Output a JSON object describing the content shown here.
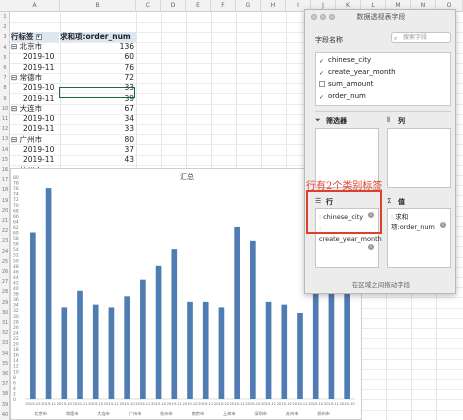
{
  "sheet": {
    "columns": [
      "A",
      "B",
      "C",
      "D",
      "E",
      "F",
      "G",
      "H",
      "I",
      "J",
      "K",
      "L",
      "M",
      "N",
      "O"
    ],
    "rows": [
      "1",
      "2",
      "3",
      "4",
      "5",
      "6",
      "7",
      "8",
      "9",
      "10",
      "11",
      "12",
      "13",
      "14",
      "15",
      "16",
      "17",
      "18",
      "19",
      "20",
      "21",
      "22",
      "23",
      "24",
      "25",
      "26",
      "27",
      "28",
      "29",
      "30",
      "31",
      "32",
      "33",
      "34",
      "35",
      "36",
      "37",
      "38",
      "39",
      "40"
    ]
  },
  "pivot": {
    "header_label": "行标签",
    "header_value": "求和项:order_num",
    "dropdown_glyph": "▾",
    "rows": [
      {
        "label": "⊟ 北京市",
        "value": "136",
        "level": 0
      },
      {
        "label": "2019-10",
        "value": "60",
        "level": 1
      },
      {
        "label": "2019-11",
        "value": "76",
        "level": 1
      },
      {
        "label": "⊟ 常德市",
        "value": "72",
        "level": 0
      },
      {
        "label": "2019-10",
        "value": "33",
        "level": 1
      },
      {
        "label": "2019-11",
        "value": "39",
        "level": 1
      },
      {
        "label": "⊟ 大连市",
        "value": "67",
        "level": 0
      },
      {
        "label": "2019-10",
        "value": "34",
        "level": 1
      },
      {
        "label": "2019-11",
        "value": "33",
        "level": 1
      },
      {
        "label": "⊟ 广州市",
        "value": "80",
        "level": 0
      },
      {
        "label": "2019-10",
        "value": "37",
        "level": 1
      },
      {
        "label": "2019-11",
        "value": "43",
        "level": 1
      },
      {
        "label": "⊟ 杭州市",
        "value": "",
        "level": 0
      }
    ]
  },
  "chart_data": {
    "type": "bar",
    "title": "汇总",
    "ylim": [
      0,
      80
    ],
    "series": [
      {
        "name": "汇总",
        "values": [
          60,
          76,
          33,
          39,
          34,
          33,
          37,
          43,
          48,
          54,
          35,
          35,
          33,
          62,
          57,
          35,
          34,
          31,
          38,
          41,
          38
        ]
      }
    ],
    "categories": [
      "2019-10",
      "2019-11",
      "2019-10",
      "2019-11",
      "2019-10",
      "2019-11",
      "2019-10",
      "2019-11",
      "2019-10",
      "2019-11",
      "2019-10",
      "2019-11",
      "2019-10",
      "2019-11",
      "2019-10",
      "2019-11",
      "2019-10",
      "2019-11",
      "2019-10",
      "2019-11",
      "2019-10"
    ],
    "city_labels": [
      "北京市",
      "常德市",
      "大连市",
      "广州市",
      "杭州市",
      "南京市",
      "上海市",
      "深圳市",
      "苏州市",
      "郑州市"
    ],
    "y_ticks": [
      "0",
      "2",
      "4",
      "6",
      "8",
      "10",
      "12",
      "14",
      "16",
      "18",
      "20",
      "22",
      "24",
      "26",
      "28",
      "30",
      "32",
      "34",
      "36",
      "38",
      "40",
      "42",
      "44",
      "46",
      "48",
      "50",
      "52",
      "54",
      "56",
      "58",
      "60",
      "62",
      "64",
      "66",
      "68",
      "70",
      "72",
      "74",
      "76",
      "78",
      "80"
    ],
    "bar_color": "#4f7db3"
  },
  "panel": {
    "title": "数据透视表字段",
    "field_name_label": "字段名称",
    "search_placeholder": "搜索字段",
    "fields": [
      {
        "name": "chinese_city",
        "checked": true
      },
      {
        "name": "create_year_month",
        "checked": true
      },
      {
        "name": "sum_amount",
        "checked": false
      },
      {
        "name": "order_num",
        "checked": true
      }
    ],
    "filter_title": "筛选器",
    "columns_title": "列",
    "rows_title": "行",
    "values_title": "值",
    "row_fields": [
      "chinese_city",
      "create_year_month"
    ],
    "value_fields": [
      "求和项:order_num"
    ],
    "footer": "在区域之间拖动字段"
  },
  "annotation": {
    "text": "行有2个类别标签"
  }
}
